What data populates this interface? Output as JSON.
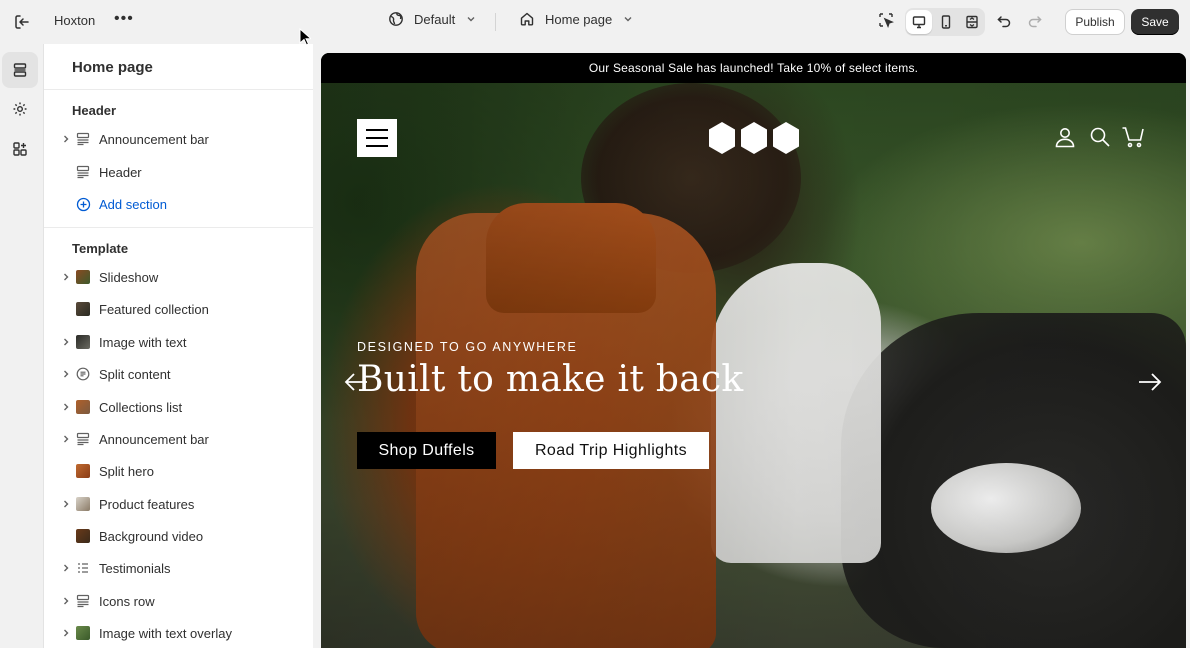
{
  "topbar": {
    "store_name": "Hoxton",
    "theme_label": "Default",
    "page_label": "Home page",
    "publish_label": "Publish",
    "save_label": "Save",
    "more_glyph": "•••"
  },
  "sidebar": {
    "title": "Home page",
    "header_group": {
      "title": "Header",
      "items": [
        {
          "label": "Announcement bar",
          "expandable": true,
          "icon": "section-layout-icon"
        },
        {
          "label": "Header",
          "expandable": false,
          "icon": "section-layout-icon"
        }
      ],
      "add_label": "Add section"
    },
    "template_group": {
      "title": "Template",
      "items": [
        {
          "label": "Slideshow",
          "expandable": true,
          "icon": "image-thumbnail"
        },
        {
          "label": "Featured collection",
          "expandable": false,
          "icon": "image-thumbnail"
        },
        {
          "label": "Image with text",
          "expandable": true,
          "icon": "image-thumbnail"
        },
        {
          "label": "Split content",
          "expandable": true,
          "icon": "text-block-icon"
        },
        {
          "label": "Collections list",
          "expandable": true,
          "icon": "image-thumbnail"
        },
        {
          "label": "Announcement bar",
          "expandable": true,
          "icon": "section-layout-icon"
        },
        {
          "label": "Split hero",
          "expandable": false,
          "icon": "image-thumbnail"
        },
        {
          "label": "Product features",
          "expandable": true,
          "icon": "image-thumbnail"
        },
        {
          "label": "Background video",
          "expandable": false,
          "icon": "image-thumbnail"
        },
        {
          "label": "Testimonials",
          "expandable": true,
          "icon": "list-icon"
        },
        {
          "label": "Icons row",
          "expandable": true,
          "icon": "section-layout-icon"
        },
        {
          "label": "Image with text overlay",
          "expandable": true,
          "icon": "image-thumbnail"
        }
      ]
    }
  },
  "preview": {
    "announcement": "Our Seasonal Sale has launched! Take 10% of select items.",
    "eyebrow": "DESIGNED TO GO ANYWHERE",
    "headline": "Built to make it back",
    "cta_primary": "Shop Duffels",
    "cta_secondary": "Road Trip Highlights"
  },
  "colors": {
    "accent_link": "#005bd3",
    "save_bg": "#303030",
    "announcement_bg": "#000000"
  }
}
